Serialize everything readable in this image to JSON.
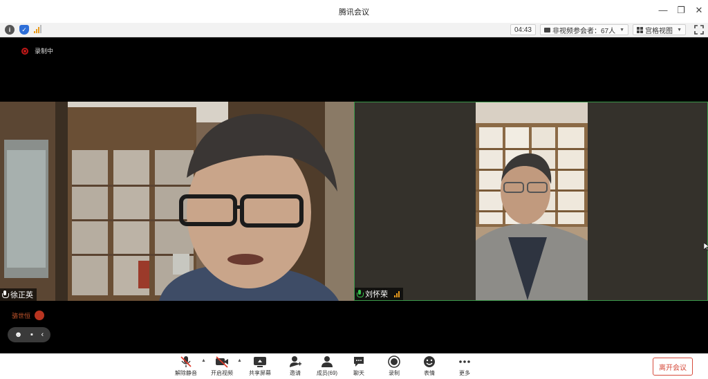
{
  "window": {
    "title": "腾讯会议"
  },
  "infobar": {
    "timer": "04:43",
    "viewers_label": "非视频参会者：67人",
    "view_label": "宫格视图"
  },
  "stage": {
    "recording_label": "录制中",
    "participants": [
      {
        "name": "徐正英",
        "mic": "on"
      },
      {
        "name": "刘怀荣",
        "mic": "speaking"
      }
    ],
    "presenter_name": "骆世恒"
  },
  "toolbar": {
    "items": [
      {
        "label": "解除静音",
        "icon": "mic-muted-icon"
      },
      {
        "label": "开启视频",
        "icon": "video-off-icon"
      },
      {
        "label": "共享屏幕",
        "icon": "screen-share-icon"
      },
      {
        "label": "邀请",
        "icon": "invite-icon"
      },
      {
        "label": "成员(69)",
        "icon": "members-icon"
      },
      {
        "label": "聊天",
        "icon": "chat-icon"
      },
      {
        "label": "录制",
        "icon": "record-icon"
      },
      {
        "label": "表情",
        "icon": "emoji-icon"
      },
      {
        "label": "更多",
        "icon": "more-icon"
      }
    ],
    "leave_label": "离开会议"
  },
  "colors": {
    "leave_red": "#d64a3a",
    "speaking_green": "#36c24b",
    "recording_red": "#c01818"
  }
}
